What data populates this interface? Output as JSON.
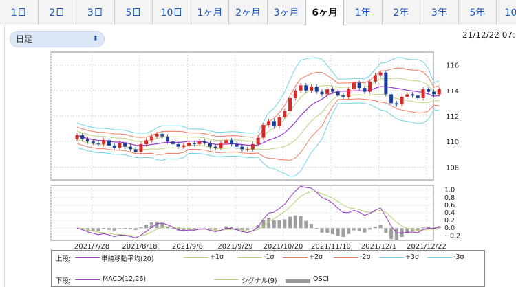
{
  "tabs": [
    "1日",
    "2日",
    "3日",
    "5日",
    "10日",
    "1ヶ月",
    "2ヶ月",
    "3ヶ月",
    "6ヶ月",
    "1年",
    "2年",
    "3年",
    "5年",
    "10年"
  ],
  "active_tab": "6ヶ月",
  "select": {
    "value": "日足"
  },
  "timestamp": "21/12/22 07:",
  "legend": {
    "upper_label": "上段:",
    "lower_label": "下段:",
    "upper": [
      {
        "name": "単純移動平均(20)",
        "color": "#9b3fc8"
      },
      {
        "name": "+1σ",
        "color": "#b9d27a"
      },
      {
        "name": "-1σ",
        "color": "#b9d27a"
      },
      {
        "name": "+2σ",
        "color": "#f07a60"
      },
      {
        "name": "-2σ",
        "color": "#f07a60"
      },
      {
        "name": "+3σ",
        "color": "#6fd2e6"
      },
      {
        "name": "-3σ",
        "color": "#6fd2e6"
      }
    ],
    "lower": [
      {
        "name": "MACD(12,26)",
        "color": "#9b3fc8"
      },
      {
        "name": "シグナル(9)",
        "color": "#b9d27a"
      },
      {
        "name": "OSCI",
        "color": "#999999"
      }
    ]
  },
  "chart_data": {
    "type": "line",
    "x_labels": [
      "2021/7/28",
      "2021/8/18",
      "2021/9/8",
      "2021/9/29",
      "2021/10/20",
      "2021/11/10",
      "2021/12/1",
      "2021/12/22"
    ],
    "upper": {
      "yticks": [
        "116",
        "114",
        "112",
        "110",
        "108"
      ],
      "ylim": [
        107,
        117
      ],
      "close": [
        110.5,
        110.2,
        110.0,
        109.9,
        109.8,
        110.1,
        109.7,
        109.5,
        109.9,
        109.6,
        109.4,
        109.2,
        109.8,
        110.1,
        110.4,
        110.6,
        110.4,
        110.0,
        109.8,
        109.6,
        109.7,
        109.9,
        109.8,
        110.0,
        109.9,
        109.6,
        109.5,
        109.9,
        110.1,
        109.8,
        109.6,
        109.4,
        109.4,
        109.8,
        110.3,
        111.3,
        111.6,
        111.2,
        111.9,
        112.4,
        113.4,
        114.0,
        114.4,
        114.0,
        114.3,
        113.9,
        113.7,
        114.1,
        113.9,
        113.6,
        113.5,
        114.1,
        114.6,
        114.2,
        113.9,
        114.7,
        115.2,
        115.4,
        113.7,
        113.0,
        112.9,
        113.5,
        113.7,
        113.6,
        113.4,
        114.1,
        113.9,
        113.7,
        114.1
      ]
    },
    "lower": {
      "yticks": [
        "1.0",
        "0.8",
        "0.6",
        "0.4",
        "0.2",
        "0.0",
        "−0.2"
      ],
      "ylim": [
        -0.32,
        1.12
      ]
    }
  }
}
